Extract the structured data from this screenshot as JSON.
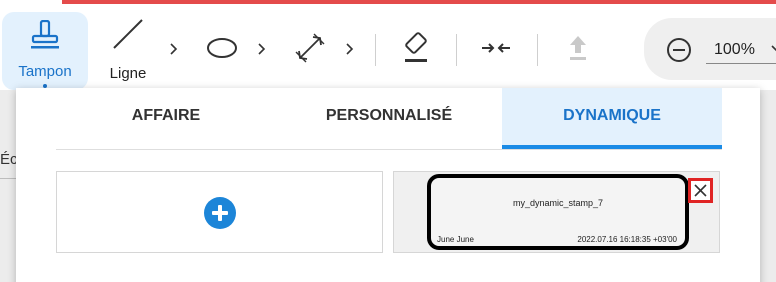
{
  "colors": {
    "accent": "#1a73c9",
    "active_bg": "#e3f1fd",
    "top_accent": "#e44b4b",
    "add_button": "#1c85d8",
    "delete_border": "#e02424"
  },
  "toolbar": {
    "tampon_label": "Tampon",
    "ligne_label": "Ligne",
    "icons": [
      "stamp-icon",
      "line-icon",
      "ellipse-icon",
      "measure-icon",
      "eraser-icon",
      "collapse-icon",
      "upload-icon",
      "zoom-out-icon"
    ],
    "zoom": {
      "value": "100%"
    }
  },
  "background": {
    "partial_text": "Éc"
  },
  "tabs": [
    {
      "label": "AFFAIRE",
      "active": false
    },
    {
      "label": "PERSONNALISÉ",
      "active": false
    },
    {
      "label": "DYNAMIQUE",
      "active": true
    }
  ],
  "stamp": {
    "name": "my_dynamic_stamp_7",
    "author": "June June",
    "date": "2022.07.16 16:18:35 +03'00"
  }
}
